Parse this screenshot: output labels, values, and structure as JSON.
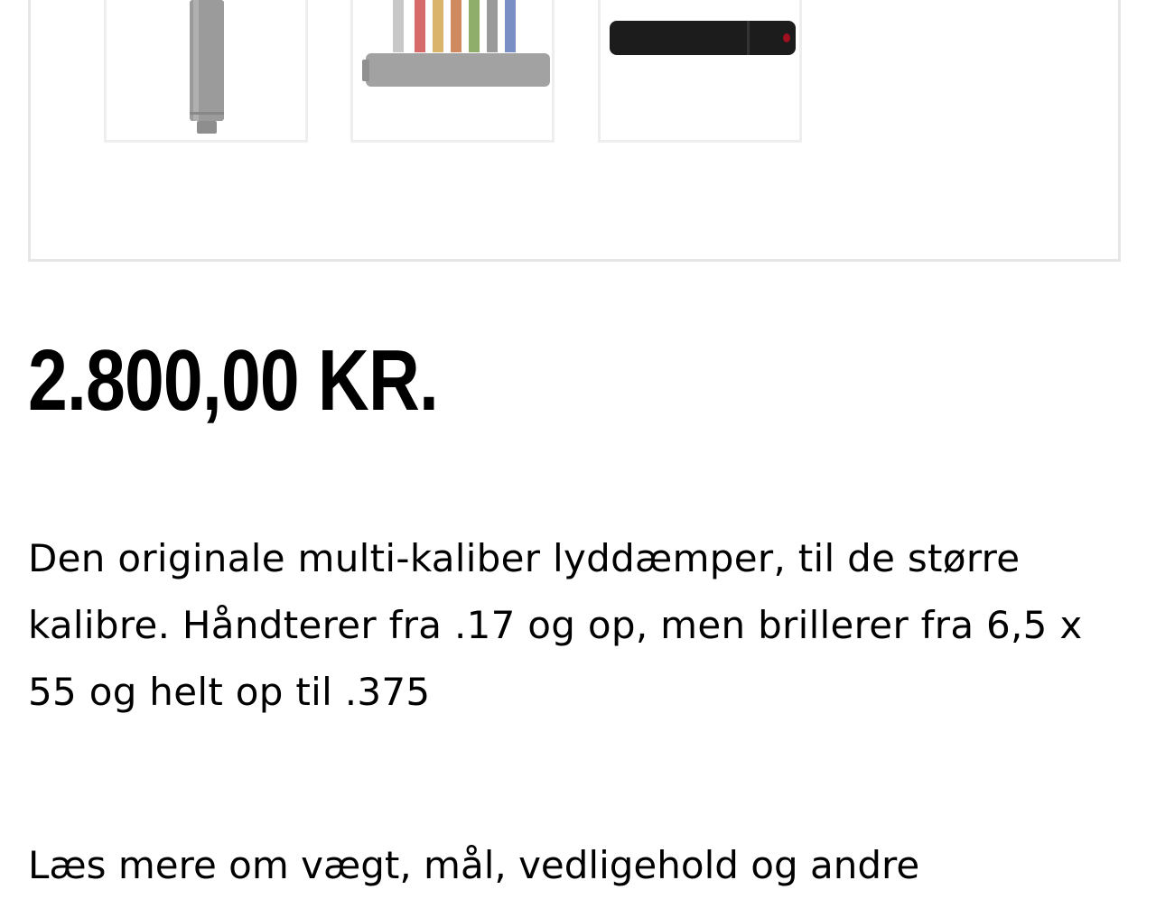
{
  "product": {
    "price": "2.800,00 KR.",
    "description": "Den originale multi-kaliber lyddæmper, til de større kalibre. Håndterer fra .17 og op, men brillerer fra 6,5 x 55 og helt op til .375",
    "read_more": "Læs mere om vægt, mål, vedligehold og andre"
  },
  "gallery": {
    "thumbnails": [
      {
        "label": "thumbnail-grey-suppressor-vertical",
        "color": "#9e9e9e"
      },
      {
        "label": "thumbnail-colored-parts-and-suppressor",
        "color": "#a0a0a0"
      },
      {
        "label": "thumbnail-black-suppressor",
        "color": "#1c1c1c"
      }
    ]
  }
}
